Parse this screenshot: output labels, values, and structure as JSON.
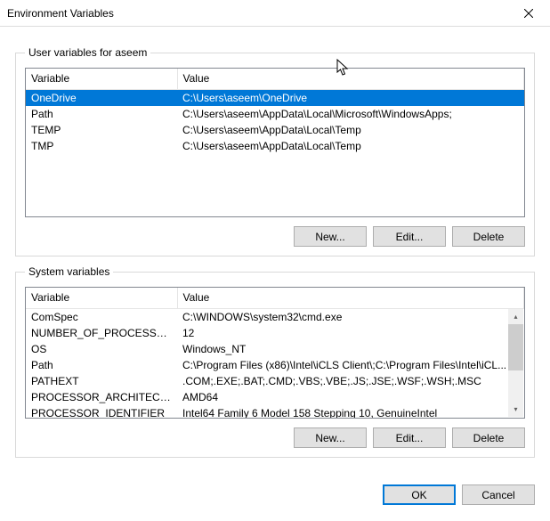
{
  "window": {
    "title": "Environment Variables"
  },
  "user_group": {
    "legend": "User variables for aseem",
    "columns": {
      "var": "Variable",
      "val": "Value"
    },
    "rows": [
      {
        "name": "OneDrive",
        "value": "C:\\Users\\aseem\\OneDrive",
        "selected": true
      },
      {
        "name": "Path",
        "value": "C:\\Users\\aseem\\AppData\\Local\\Microsoft\\WindowsApps;",
        "selected": false
      },
      {
        "name": "TEMP",
        "value": "C:\\Users\\aseem\\AppData\\Local\\Temp",
        "selected": false
      },
      {
        "name": "TMP",
        "value": "C:\\Users\\aseem\\AppData\\Local\\Temp",
        "selected": false
      }
    ],
    "buttons": {
      "new": "New...",
      "edit": "Edit...",
      "delete": "Delete"
    }
  },
  "system_group": {
    "legend": "System variables",
    "columns": {
      "var": "Variable",
      "val": "Value"
    },
    "rows": [
      {
        "name": "ComSpec",
        "value": "C:\\WINDOWS\\system32\\cmd.exe"
      },
      {
        "name": "NUMBER_OF_PROCESSORS",
        "value": "12"
      },
      {
        "name": "OS",
        "value": "Windows_NT"
      },
      {
        "name": "Path",
        "value": "C:\\Program Files (x86)\\Intel\\iCLS Client\\;C:\\Program Files\\Intel\\iCL..."
      },
      {
        "name": "PATHEXT",
        "value": ".COM;.EXE;.BAT;.CMD;.VBS;.VBE;.JS;.JSE;.WSF;.WSH;.MSC"
      },
      {
        "name": "PROCESSOR_ARCHITECTURE",
        "value": "AMD64"
      },
      {
        "name": "PROCESSOR_IDENTIFIER",
        "value": "Intel64 Family 6 Model 158 Stepping 10, GenuineIntel"
      }
    ],
    "buttons": {
      "new": "New...",
      "edit": "Edit...",
      "delete": "Delete"
    }
  },
  "footer": {
    "ok": "OK",
    "cancel": "Cancel"
  }
}
